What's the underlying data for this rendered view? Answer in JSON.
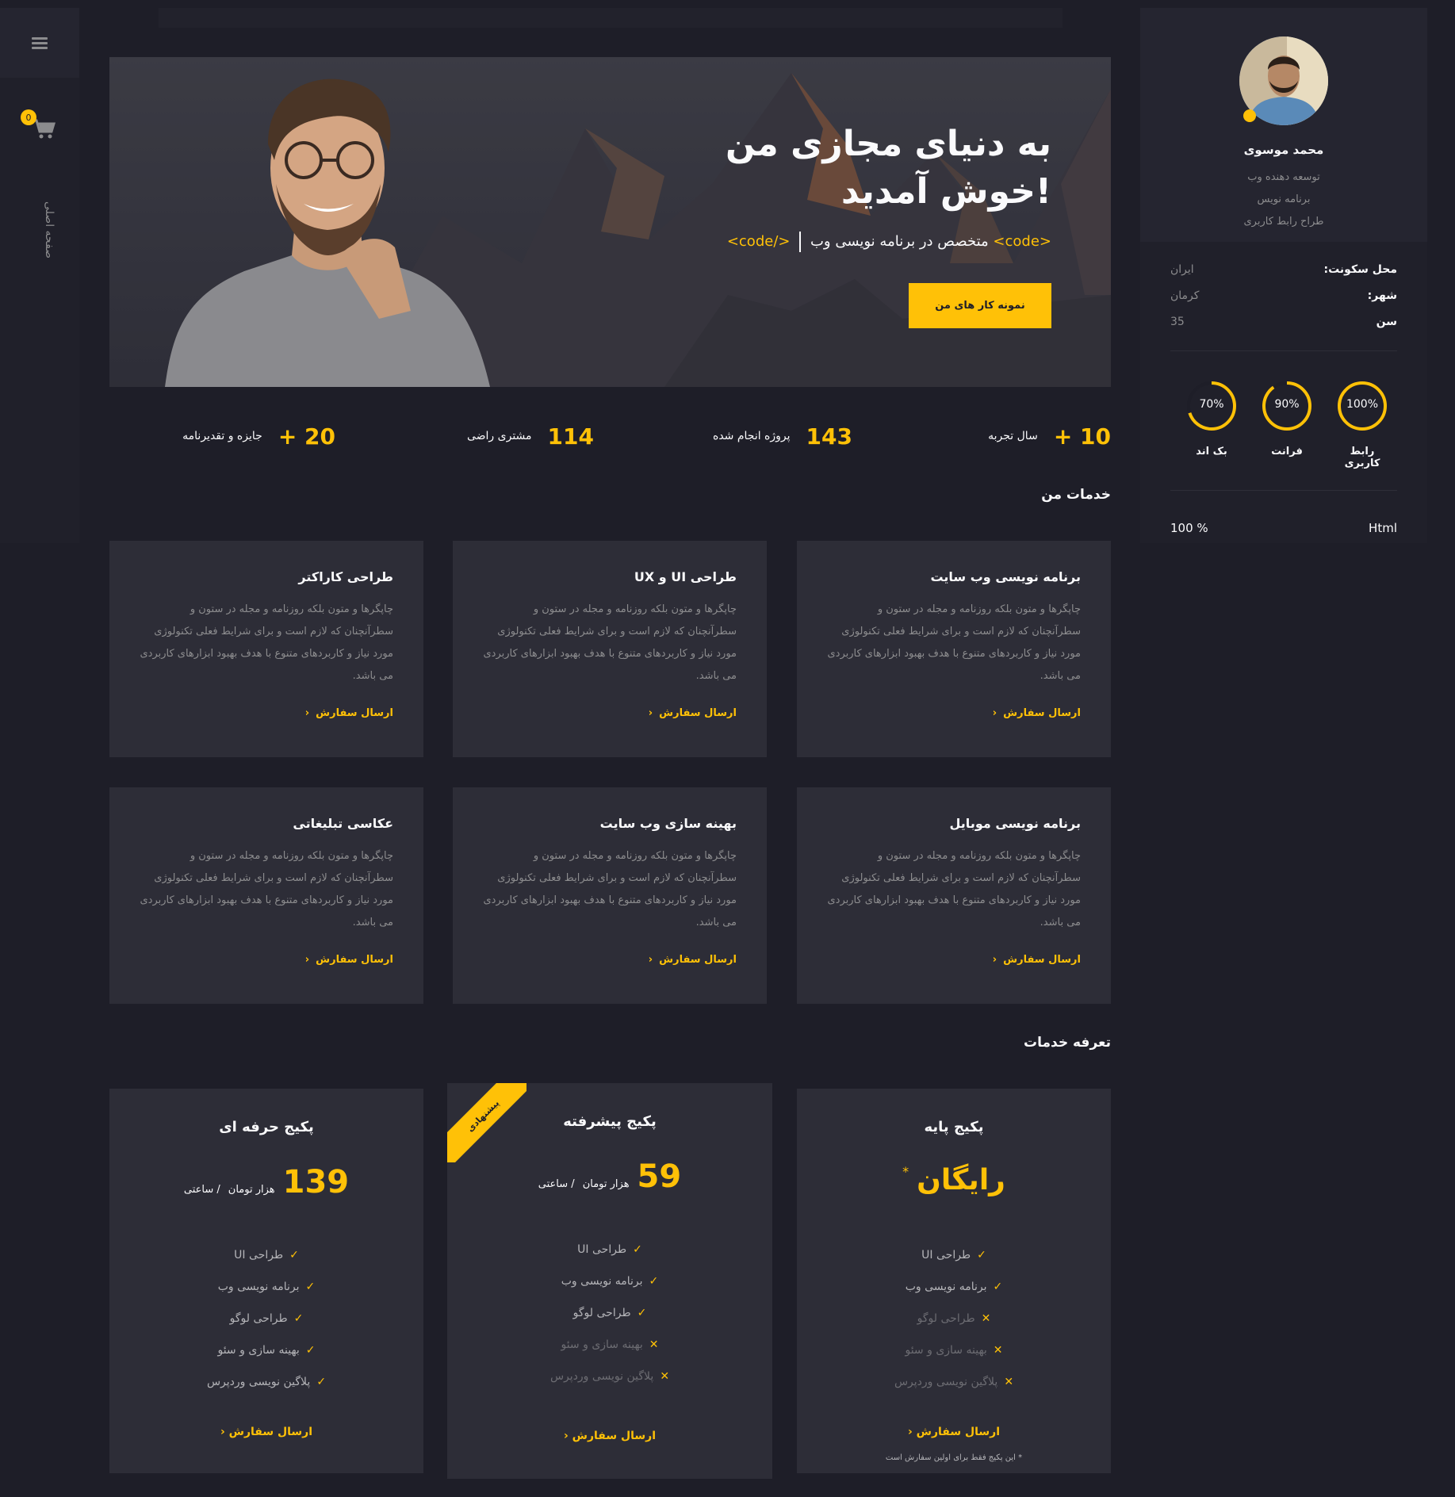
{
  "sidebar_left": {
    "cart_count": "0",
    "home_label": "صفحه اصلی"
  },
  "hero": {
    "title_line1": "به دنیای مجازی من",
    "title_line2": "خوش آمدید!",
    "code_open": "<code>",
    "subtitle_text": "متخصص در  برنامه نویسی وب",
    "code_close": "</code>",
    "button_label": "نمونه کار های من"
  },
  "stats": [
    {
      "num": "10 +",
      "label": "سال تجربه"
    },
    {
      "num": "143",
      "label": "پروژه انجام شده"
    },
    {
      "num": "114",
      "label": "مشتری راضی"
    },
    {
      "num": "20 +",
      "label": "جایزه و تقدیرنامه"
    }
  ],
  "services": {
    "title": "خدمات من",
    "body": "چاپگرها و متون بلکه روزنامه و مجله در ستون و سطرآنچنان که لازم است و برای شرایط فعلی تکنولوژی مورد نیاز و کاربردهای متنوع با هدف بهبود ابزارهای کاربردی می باشد.",
    "link_label": "ارسال سفارش",
    "items": [
      {
        "title": "برنامه نویسی وب سایت"
      },
      {
        "title": "طراحی UI و UX"
      },
      {
        "title": "طراحی کاراکتر"
      },
      {
        "title": "برنامه نویسی موبایل"
      },
      {
        "title": "بهینه سازی وب سایت"
      },
      {
        "title": "عکاسی تبلیغاتی"
      }
    ]
  },
  "pricing": {
    "title": "تعرفه خدمات",
    "link_label": "ارسال سفارش",
    "unit_label": "هزار تومان",
    "per_label": "/ ساعتی",
    "plans": [
      {
        "name": "پکیج پایه",
        "price": "رایگان",
        "asterisk": "*",
        "note": "* این پکیج فقط برای اولین سفارش است",
        "features": [
          {
            "label": "طراحی UI",
            "included": true
          },
          {
            "label": "برنامه نویسی وب",
            "included": true
          },
          {
            "label": "طراحی لوگو",
            "included": false
          },
          {
            "label": "بهینه سازی و سئو",
            "included": false
          },
          {
            "label": "پلاگین نویسی وردپرس",
            "included": false
          }
        ]
      },
      {
        "name": "پکیج پیشرفته",
        "price": "59",
        "ribbon": "پیشنهادی",
        "features": [
          {
            "label": "طراحی UI",
            "included": true
          },
          {
            "label": "برنامه نویسی وب",
            "included": true
          },
          {
            "label": "طراحی لوگو",
            "included": true
          },
          {
            "label": "بهینه سازی و سئو",
            "included": false
          },
          {
            "label": "پلاگین نویسی وردپرس",
            "included": false
          }
        ]
      },
      {
        "name": "پکیج حرفه ای",
        "price": "139",
        "features": [
          {
            "label": "طراحی UI",
            "included": true
          },
          {
            "label": "برنامه نویسی وب",
            "included": true
          },
          {
            "label": "طراحی لوگو",
            "included": true
          },
          {
            "label": "بهینه سازی و سئو",
            "included": true
          },
          {
            "label": "پلاگین نویسی وردپرس",
            "included": true
          }
        ]
      }
    ]
  },
  "profile": {
    "name": "محمد موسوی",
    "roles": [
      "توسعه دهنده وب",
      "برنامه نویس",
      "طراح رابط کاربری"
    ],
    "info": [
      {
        "key": "محل سکونت:",
        "value": "ایران"
      },
      {
        "key": "شهر:",
        "value": "کرمان"
      },
      {
        "key": "سن",
        "value": "35"
      }
    ],
    "skills_rings": [
      {
        "label": "رابط کاربری",
        "value": "100%",
        "fraction": 1.0
      },
      {
        "label": "فرانت",
        "value": "90%",
        "fraction": 0.9
      },
      {
        "label": "بک اند",
        "value": "70%",
        "fraction": 0.7
      }
    ],
    "skill_bar": {
      "label": "Html",
      "value": "100 %"
    }
  },
  "colors": {
    "accent": "#ffc107",
    "background": "#1e1e28",
    "card": "#2d2d37",
    "muted_text": "#8c8c8e"
  }
}
